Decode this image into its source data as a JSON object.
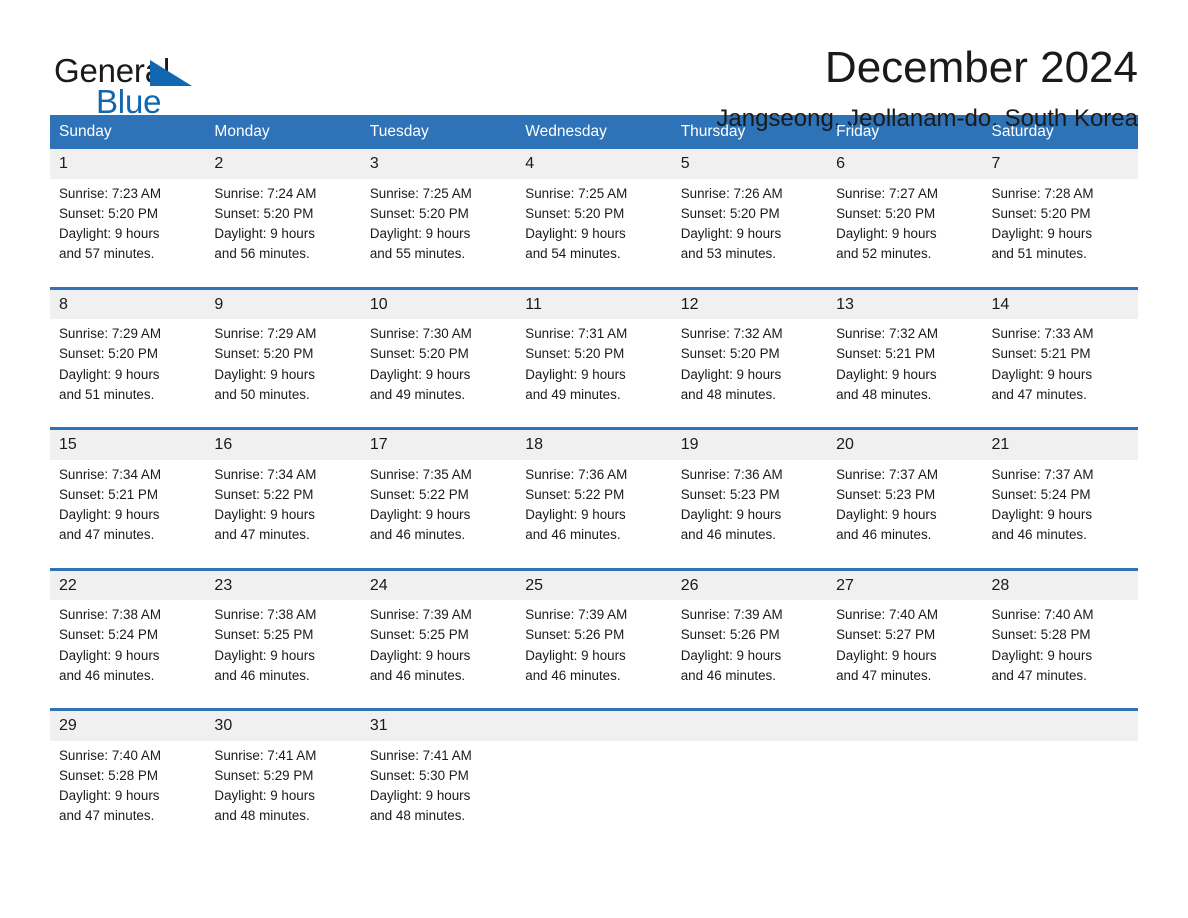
{
  "logo": {
    "word_general": "General",
    "word_blue": "Blue",
    "triangle_color": "#1267b1"
  },
  "header": {
    "title": "December 2024",
    "subtitle": "Jangseong, Jeollanam-do, South Korea"
  },
  "theme": {
    "header_blue": "#2e72b8",
    "daynum_band": "#f0f0f0",
    "text": "#1a1a1a",
    "header_text": "#ffffff"
  },
  "calendar": {
    "weekday_headers": [
      "Sunday",
      "Monday",
      "Tuesday",
      "Wednesday",
      "Thursday",
      "Friday",
      "Saturday"
    ],
    "labels": {
      "sunrise_prefix": "Sunrise:",
      "sunset_prefix": "Sunset:",
      "daylight_prefix": "Daylight:"
    },
    "weeks": [
      {
        "days": [
          {
            "num": "1",
            "sunrise": "Sunrise: 7:23 AM",
            "sunset": "Sunset: 5:20 PM",
            "daylight_1": "Daylight: 9 hours",
            "daylight_2": "and 57 minutes."
          },
          {
            "num": "2",
            "sunrise": "Sunrise: 7:24 AM",
            "sunset": "Sunset: 5:20 PM",
            "daylight_1": "Daylight: 9 hours",
            "daylight_2": "and 56 minutes."
          },
          {
            "num": "3",
            "sunrise": "Sunrise: 7:25 AM",
            "sunset": "Sunset: 5:20 PM",
            "daylight_1": "Daylight: 9 hours",
            "daylight_2": "and 55 minutes."
          },
          {
            "num": "4",
            "sunrise": "Sunrise: 7:25 AM",
            "sunset": "Sunset: 5:20 PM",
            "daylight_1": "Daylight: 9 hours",
            "daylight_2": "and 54 minutes."
          },
          {
            "num": "5",
            "sunrise": "Sunrise: 7:26 AM",
            "sunset": "Sunset: 5:20 PM",
            "daylight_1": "Daylight: 9 hours",
            "daylight_2": "and 53 minutes."
          },
          {
            "num": "6",
            "sunrise": "Sunrise: 7:27 AM",
            "sunset": "Sunset: 5:20 PM",
            "daylight_1": "Daylight: 9 hours",
            "daylight_2": "and 52 minutes."
          },
          {
            "num": "7",
            "sunrise": "Sunrise: 7:28 AM",
            "sunset": "Sunset: 5:20 PM",
            "daylight_1": "Daylight: 9 hours",
            "daylight_2": "and 51 minutes."
          }
        ]
      },
      {
        "days": [
          {
            "num": "8",
            "sunrise": "Sunrise: 7:29 AM",
            "sunset": "Sunset: 5:20 PM",
            "daylight_1": "Daylight: 9 hours",
            "daylight_2": "and 51 minutes."
          },
          {
            "num": "9",
            "sunrise": "Sunrise: 7:29 AM",
            "sunset": "Sunset: 5:20 PM",
            "daylight_1": "Daylight: 9 hours",
            "daylight_2": "and 50 minutes."
          },
          {
            "num": "10",
            "sunrise": "Sunrise: 7:30 AM",
            "sunset": "Sunset: 5:20 PM",
            "daylight_1": "Daylight: 9 hours",
            "daylight_2": "and 49 minutes."
          },
          {
            "num": "11",
            "sunrise": "Sunrise: 7:31 AM",
            "sunset": "Sunset: 5:20 PM",
            "daylight_1": "Daylight: 9 hours",
            "daylight_2": "and 49 minutes."
          },
          {
            "num": "12",
            "sunrise": "Sunrise: 7:32 AM",
            "sunset": "Sunset: 5:20 PM",
            "daylight_1": "Daylight: 9 hours",
            "daylight_2": "and 48 minutes."
          },
          {
            "num": "13",
            "sunrise": "Sunrise: 7:32 AM",
            "sunset": "Sunset: 5:21 PM",
            "daylight_1": "Daylight: 9 hours",
            "daylight_2": "and 48 minutes."
          },
          {
            "num": "14",
            "sunrise": "Sunrise: 7:33 AM",
            "sunset": "Sunset: 5:21 PM",
            "daylight_1": "Daylight: 9 hours",
            "daylight_2": "and 47 minutes."
          }
        ]
      },
      {
        "days": [
          {
            "num": "15",
            "sunrise": "Sunrise: 7:34 AM",
            "sunset": "Sunset: 5:21 PM",
            "daylight_1": "Daylight: 9 hours",
            "daylight_2": "and 47 minutes."
          },
          {
            "num": "16",
            "sunrise": "Sunrise: 7:34 AM",
            "sunset": "Sunset: 5:22 PM",
            "daylight_1": "Daylight: 9 hours",
            "daylight_2": "and 47 minutes."
          },
          {
            "num": "17",
            "sunrise": "Sunrise: 7:35 AM",
            "sunset": "Sunset: 5:22 PM",
            "daylight_1": "Daylight: 9 hours",
            "daylight_2": "and 46 minutes."
          },
          {
            "num": "18",
            "sunrise": "Sunrise: 7:36 AM",
            "sunset": "Sunset: 5:22 PM",
            "daylight_1": "Daylight: 9 hours",
            "daylight_2": "and 46 minutes."
          },
          {
            "num": "19",
            "sunrise": "Sunrise: 7:36 AM",
            "sunset": "Sunset: 5:23 PM",
            "daylight_1": "Daylight: 9 hours",
            "daylight_2": "and 46 minutes."
          },
          {
            "num": "20",
            "sunrise": "Sunrise: 7:37 AM",
            "sunset": "Sunset: 5:23 PM",
            "daylight_1": "Daylight: 9 hours",
            "daylight_2": "and 46 minutes."
          },
          {
            "num": "21",
            "sunrise": "Sunrise: 7:37 AM",
            "sunset": "Sunset: 5:24 PM",
            "daylight_1": "Daylight: 9 hours",
            "daylight_2": "and 46 minutes."
          }
        ]
      },
      {
        "days": [
          {
            "num": "22",
            "sunrise": "Sunrise: 7:38 AM",
            "sunset": "Sunset: 5:24 PM",
            "daylight_1": "Daylight: 9 hours",
            "daylight_2": "and 46 minutes."
          },
          {
            "num": "23",
            "sunrise": "Sunrise: 7:38 AM",
            "sunset": "Sunset: 5:25 PM",
            "daylight_1": "Daylight: 9 hours",
            "daylight_2": "and 46 minutes."
          },
          {
            "num": "24",
            "sunrise": "Sunrise: 7:39 AM",
            "sunset": "Sunset: 5:25 PM",
            "daylight_1": "Daylight: 9 hours",
            "daylight_2": "and 46 minutes."
          },
          {
            "num": "25",
            "sunrise": "Sunrise: 7:39 AM",
            "sunset": "Sunset: 5:26 PM",
            "daylight_1": "Daylight: 9 hours",
            "daylight_2": "and 46 minutes."
          },
          {
            "num": "26",
            "sunrise": "Sunrise: 7:39 AM",
            "sunset": "Sunset: 5:26 PM",
            "daylight_1": "Daylight: 9 hours",
            "daylight_2": "and 46 minutes."
          },
          {
            "num": "27",
            "sunrise": "Sunrise: 7:40 AM",
            "sunset": "Sunset: 5:27 PM",
            "daylight_1": "Daylight: 9 hours",
            "daylight_2": "and 47 minutes."
          },
          {
            "num": "28",
            "sunrise": "Sunrise: 7:40 AM",
            "sunset": "Sunset: 5:28 PM",
            "daylight_1": "Daylight: 9 hours",
            "daylight_2": "and 47 minutes."
          }
        ]
      },
      {
        "days": [
          {
            "num": "29",
            "sunrise": "Sunrise: 7:40 AM",
            "sunset": "Sunset: 5:28 PM",
            "daylight_1": "Daylight: 9 hours",
            "daylight_2": "and 47 minutes."
          },
          {
            "num": "30",
            "sunrise": "Sunrise: 7:41 AM",
            "sunset": "Sunset: 5:29 PM",
            "daylight_1": "Daylight: 9 hours",
            "daylight_2": "and 48 minutes."
          },
          {
            "num": "31",
            "sunrise": "Sunrise: 7:41 AM",
            "sunset": "Sunset: 5:30 PM",
            "daylight_1": "Daylight: 9 hours",
            "daylight_2": "and 48 minutes."
          },
          {
            "num": "",
            "sunrise": "",
            "sunset": "",
            "daylight_1": "",
            "daylight_2": ""
          },
          {
            "num": "",
            "sunrise": "",
            "sunset": "",
            "daylight_1": "",
            "daylight_2": ""
          },
          {
            "num": "",
            "sunrise": "",
            "sunset": "",
            "daylight_1": "",
            "daylight_2": ""
          },
          {
            "num": "",
            "sunrise": "",
            "sunset": "",
            "daylight_1": "",
            "daylight_2": ""
          }
        ]
      }
    ]
  }
}
